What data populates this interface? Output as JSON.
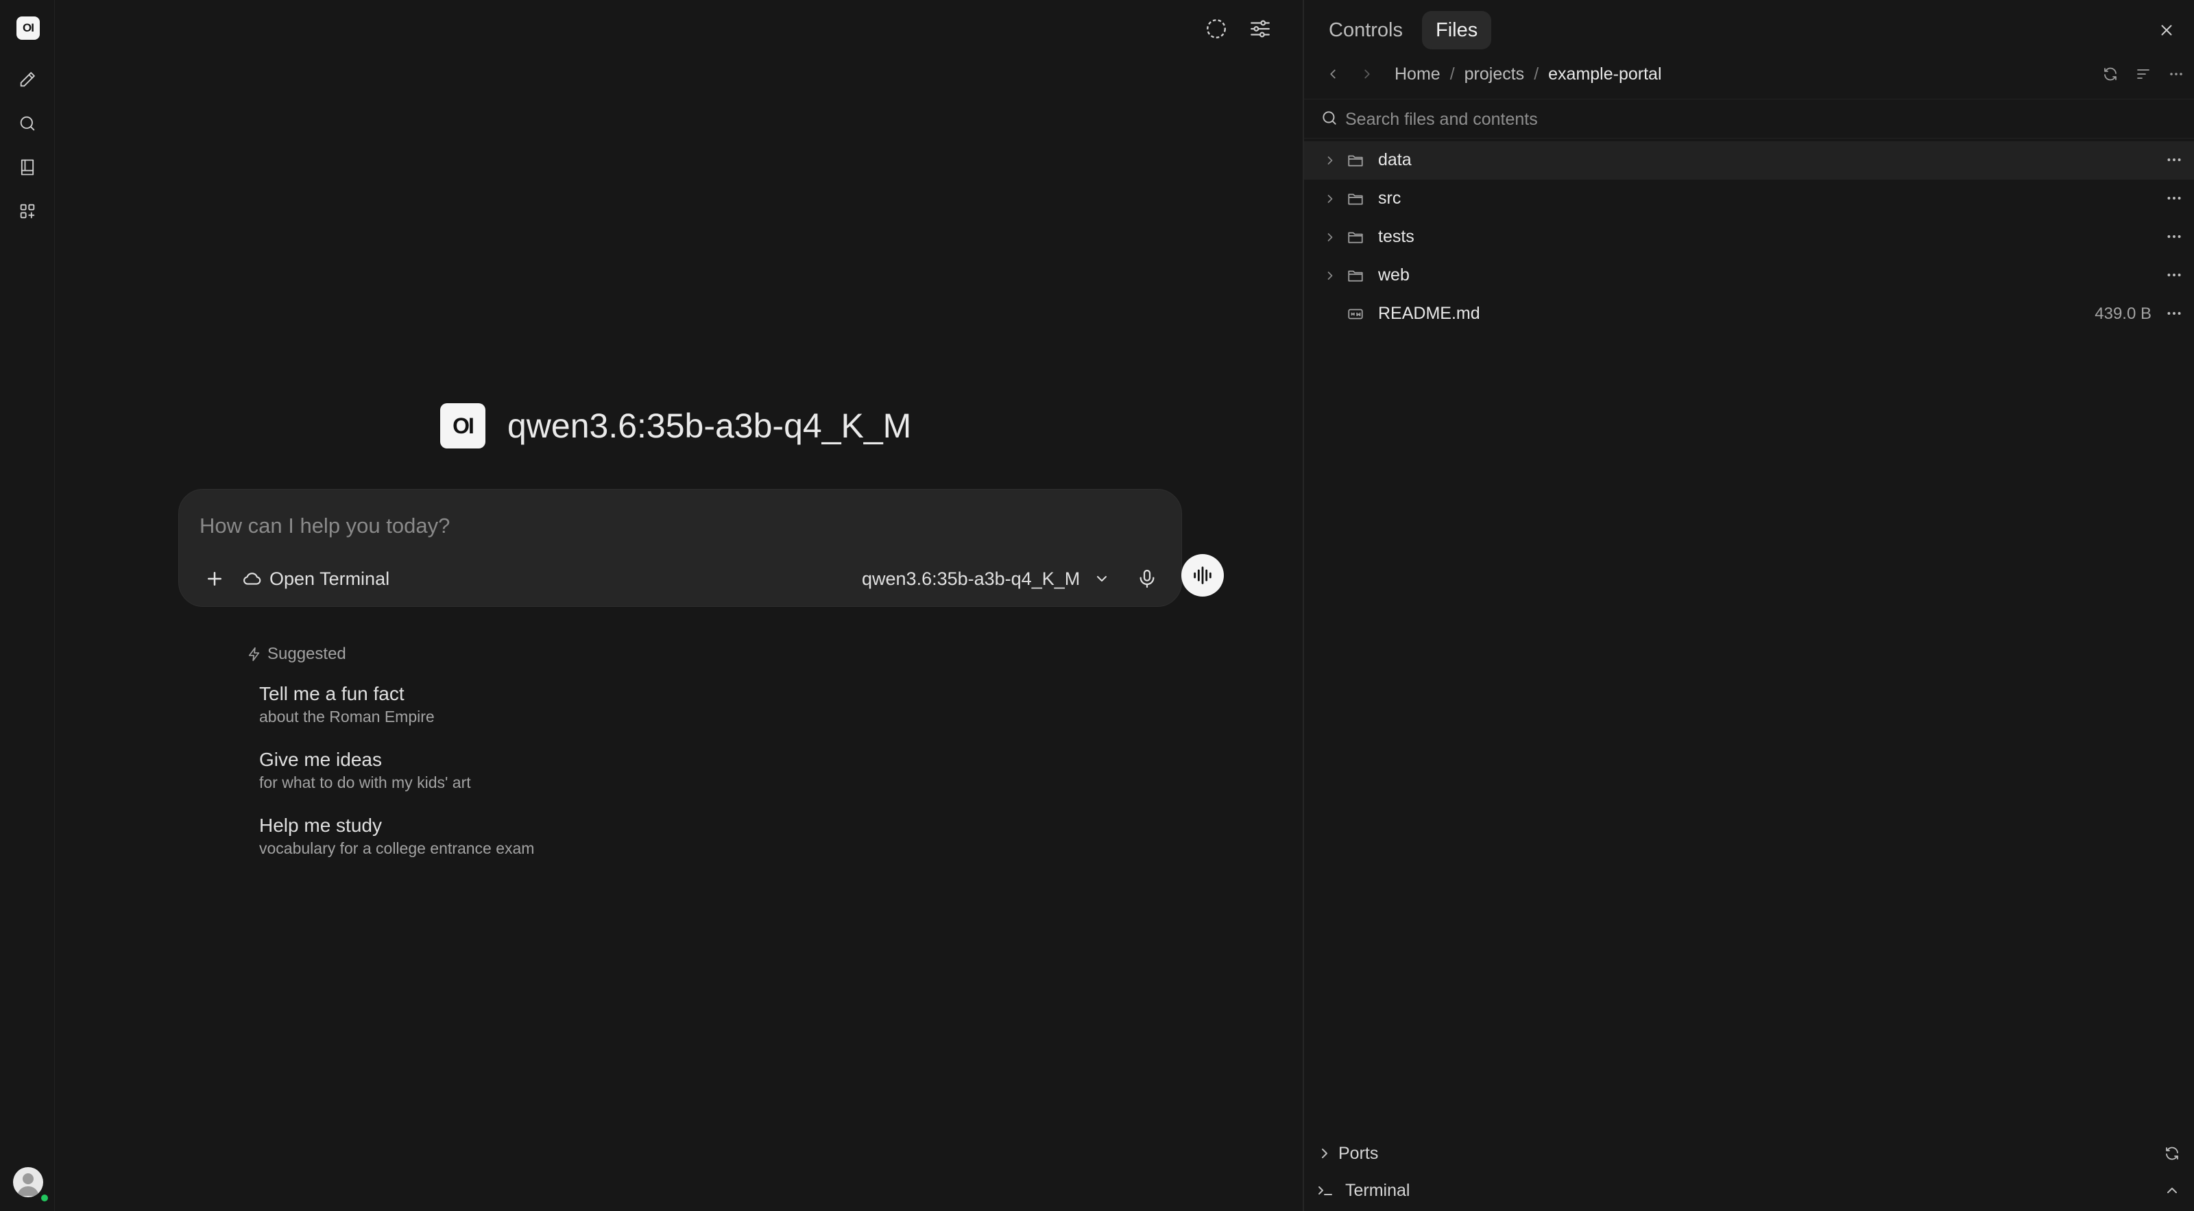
{
  "rail": {
    "logo_text": "OI",
    "items": [
      "new-chat",
      "search",
      "notes",
      "workspace"
    ]
  },
  "main": {
    "model_logo_text": "OI",
    "model_name": "qwen3.6:35b-a3b-q4_K_M",
    "composer": {
      "placeholder": "How can I help you today?",
      "terminal_label": "Open Terminal",
      "selected_model": "qwen3.6:35b-a3b-q4_K_M"
    },
    "suggested": {
      "heading": "Suggested",
      "items": [
        {
          "title": "Tell me a fun fact",
          "subtitle": "about the Roman Empire"
        },
        {
          "title": "Give me ideas",
          "subtitle": "for what to do with my kids' art"
        },
        {
          "title": "Help me study",
          "subtitle": "vocabulary for a college entrance exam"
        }
      ]
    }
  },
  "panel": {
    "tabs": [
      {
        "label": "Controls",
        "active": false
      },
      {
        "label": "Files",
        "active": true
      }
    ],
    "breadcrumb": [
      "Home",
      "projects",
      "example-portal"
    ],
    "search_placeholder": "Search files and contents",
    "files": [
      {
        "name": "data",
        "type": "folder",
        "size": ""
      },
      {
        "name": "src",
        "type": "folder",
        "size": ""
      },
      {
        "name": "tests",
        "type": "folder",
        "size": ""
      },
      {
        "name": "web",
        "type": "folder",
        "size": ""
      },
      {
        "name": "README.md",
        "type": "file",
        "size": "439.0 B"
      }
    ],
    "ports_label": "Ports",
    "terminal_label": "Terminal"
  },
  "colors": {
    "background": "#171717",
    "composer": "#262626",
    "active_tab": "#2a2a2a",
    "online": "#22c55e"
  }
}
